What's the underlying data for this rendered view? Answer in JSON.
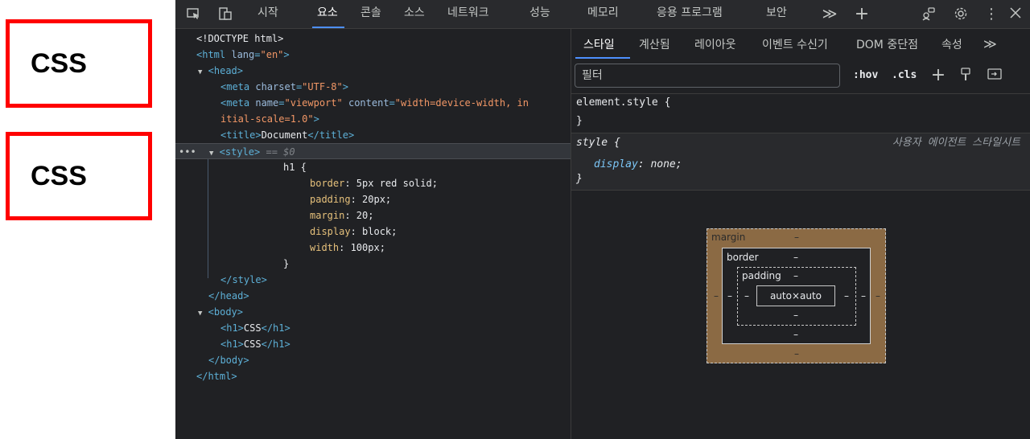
{
  "page": {
    "headings": [
      "CSS",
      "CSS"
    ]
  },
  "devtools": {
    "toolbar": {
      "tabs": [
        "시작",
        "요소",
        "콘솔",
        "소스",
        "네트워크",
        "성능",
        "메모리",
        "응용 프로그램",
        "보안"
      ],
      "active_tab": "요소",
      "more": "≫",
      "add": "+"
    },
    "elements": {
      "selected_suffix": "== $0"
    },
    "styles": {
      "tabs": [
        "스타일",
        "계산됨",
        "레이아웃",
        "이벤트 수신기",
        "DOM 중단점",
        "속성"
      ],
      "more": "≫",
      "filter_placeholder": "필터",
      "hov": ":hov",
      "cls": ".cls",
      "element_style_open": "element.style {",
      "element_style_close": "}",
      "ua_rule_selector": "style {",
      "ua_rule_label": "사용자 에이전트 스타일시트",
      "ua_prop": "display",
      "ua_value": "none;",
      "ua_close": "}"
    },
    "box_model": {
      "margin_label": "margin",
      "border_label": "border",
      "padding_label": "padding",
      "content": "auto×auto",
      "dash": "–"
    }
  }
}
